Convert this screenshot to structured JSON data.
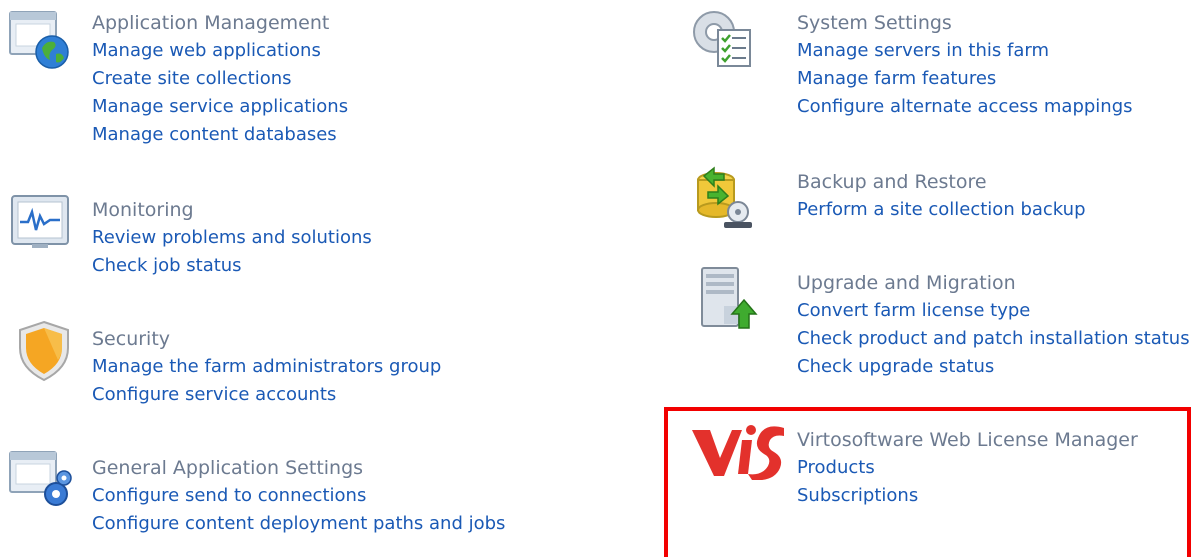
{
  "left_column": [
    {
      "id": "application-management",
      "icon": "application-management-icon",
      "title": "Application Management",
      "links": [
        "Manage web applications",
        "Create site collections",
        "Manage service applications",
        "Manage content databases"
      ]
    },
    {
      "id": "monitoring",
      "icon": "monitoring-icon",
      "title": "Monitoring",
      "links": [
        "Review problems and solutions",
        "Check job status"
      ]
    },
    {
      "id": "security",
      "icon": "security-shield-icon",
      "title": "Security",
      "links": [
        "Manage the farm administrators group",
        "Configure service accounts"
      ]
    },
    {
      "id": "general-application-settings",
      "icon": "general-application-settings-icon",
      "title": "General Application Settings",
      "links": [
        "Configure send to connections",
        "Configure content deployment paths and jobs"
      ]
    }
  ],
  "right_column": [
    {
      "id": "system-settings",
      "icon": "system-settings-icon",
      "title": "System Settings",
      "links": [
        "Manage servers in this farm",
        "Manage farm features",
        "Configure alternate access mappings"
      ]
    },
    {
      "id": "backup-and-restore",
      "icon": "backup-restore-icon",
      "title": "Backup and Restore",
      "links": [
        "Perform a site collection backup"
      ]
    },
    {
      "id": "upgrade-and-migration",
      "icon": "upgrade-migration-icon",
      "title": "Upgrade and Migration",
      "links": [
        "Convert farm license type",
        "Check product and patch installation status",
        "Check upgrade status"
      ]
    },
    {
      "id": "virtosoftware-web-license-manager",
      "icon": "virtosoftware-logo-icon",
      "title": "Virtosoftware Web License Manager",
      "links": [
        "Products",
        "Subscriptions"
      ]
    }
  ],
  "colors": {
    "title": "#6c7a90",
    "link": "#1a59b5",
    "highlight_border": "#f20000",
    "logo_red": "#e3312c"
  }
}
